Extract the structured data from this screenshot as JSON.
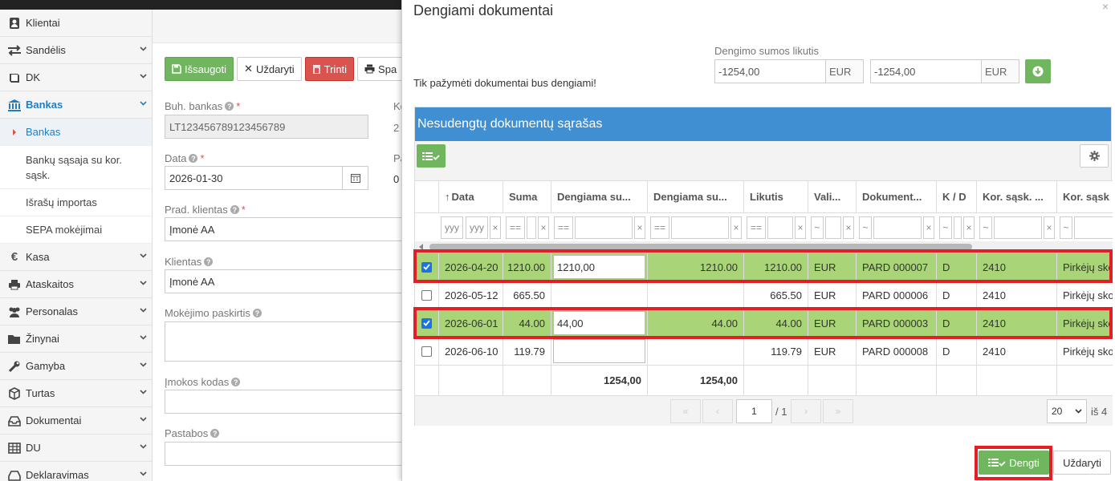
{
  "sidebar": {
    "items": [
      {
        "label": "Klientai",
        "icon": "user-icon"
      },
      {
        "label": "Sandėlis",
        "icon": "exchange-icon"
      },
      {
        "label": "DK",
        "icon": "book-icon"
      },
      {
        "label": "Bankas",
        "icon": "bank-icon"
      },
      {
        "label": "Kasa",
        "icon": "euro-icon"
      },
      {
        "label": "Ataskaitos",
        "icon": "printer-icon"
      },
      {
        "label": "Personalas",
        "icon": "users-icon"
      },
      {
        "label": "Žinynai",
        "icon": "folder-icon"
      },
      {
        "label": "Gamyba",
        "icon": "wrench-icon"
      },
      {
        "label": "Turtas",
        "icon": "cube-icon"
      },
      {
        "label": "Dokumentai",
        "icon": "inbox-icon"
      },
      {
        "label": "DU",
        "icon": "table-icon"
      },
      {
        "label": "Deklaravimas",
        "icon": "inbox-icon"
      }
    ],
    "bank_sub": [
      "Bankas",
      "Bankų sąsaja su kor. sąsk.",
      "Išrašų importas",
      "SEPA mokėjimai"
    ]
  },
  "form": {
    "buttons": {
      "save": "Išsaugoti",
      "close": "Uždaryti",
      "delete": "Trinti",
      "print": "Spa"
    },
    "buh_bankas_label": "Buh. bankas",
    "buh_bankas_value": "LT123456789123456789",
    "data_label": "Data",
    "data_value": "2026-01-30",
    "prad_klientas_label": "Prad. klientas",
    "prad_klientas_value": "Įmonė AA",
    "klientas_label": "Klientas",
    "klientas_value": "Įmonė AA",
    "paskirtis_label": "Mokėjimo paskirtis",
    "imokos_kodas_label": "Įmokos kodas",
    "pastabos_label": "Pastabos",
    "right_col_labels": [
      "Ko",
      "2",
      "Pa",
      "0"
    ]
  },
  "modal": {
    "title": "Dengiami dokumentai",
    "close": "×",
    "note": "Tik pažymėti dokumentai bus dengiami!",
    "sum_label": "Dengimo sumos likutis",
    "sum1": "-1254,00",
    "cur1": "EUR",
    "sum2": "-1254,00",
    "cur2": "EUR",
    "grid_title": "Nesudengtų dokumentų sąrašas",
    "columns": [
      "Data",
      "Suma",
      "Dengiama su...",
      "Dengiama su...",
      "Likutis",
      "Vali...",
      "Dokument...",
      "K / D",
      "Kor. sąsk. ...",
      "Kor. sąsk"
    ],
    "filters": {
      "date_a": "yyy",
      "date_b": "yyy",
      "eq": "==",
      "tilde": "~",
      "x": "×"
    },
    "rows": [
      {
        "checked": true,
        "date": "2026-04-20",
        "suma": "1210.00",
        "input": "1210,00",
        "dengiama": "1210.00",
        "likutis": "1210.00",
        "valiuta": "EUR",
        "dok": "PARD 000007",
        "kd": "D",
        "kor": "2410",
        "kor2": "Pirkėjų sko"
      },
      {
        "checked": false,
        "date": "2026-05-12",
        "suma": "665.50",
        "input": "",
        "dengiama": "",
        "likutis": "665.50",
        "valiuta": "EUR",
        "dok": "PARD 000006",
        "kd": "D",
        "kor": "2410",
        "kor2": "Pirkėjų sko"
      },
      {
        "checked": true,
        "date": "2026-06-01",
        "suma": "44.00",
        "input": "44,00",
        "dengiama": "44.00",
        "likutis": "44.00",
        "valiuta": "EUR",
        "dok": "PARD 000003",
        "kd": "D",
        "kor": "2410",
        "kor2": "Pirkėjų sko"
      },
      {
        "checked": false,
        "date": "2026-06-10",
        "suma": "119.79",
        "input": "",
        "dengiama": "",
        "likutis": "119.79",
        "valiuta": "EUR",
        "dok": "PARD 000008",
        "kd": "D",
        "kor": "2410",
        "kor2": "Pirkėjų sko"
      }
    ],
    "totals": {
      "dengiama_input": "1254,00",
      "dengiama": "1254,00"
    },
    "pager": {
      "page": "1",
      "of": "/ 1",
      "page_size": "20",
      "total": "iš 4"
    },
    "footer": {
      "dengti": "Dengti",
      "uzdaryti": "Uždaryti"
    },
    "colors": {
      "header_blue": "#3f8fd2",
      "selected_green": "#a9d578",
      "button_green": "#6fb65e",
      "highlight_red": "#e31e24"
    }
  }
}
